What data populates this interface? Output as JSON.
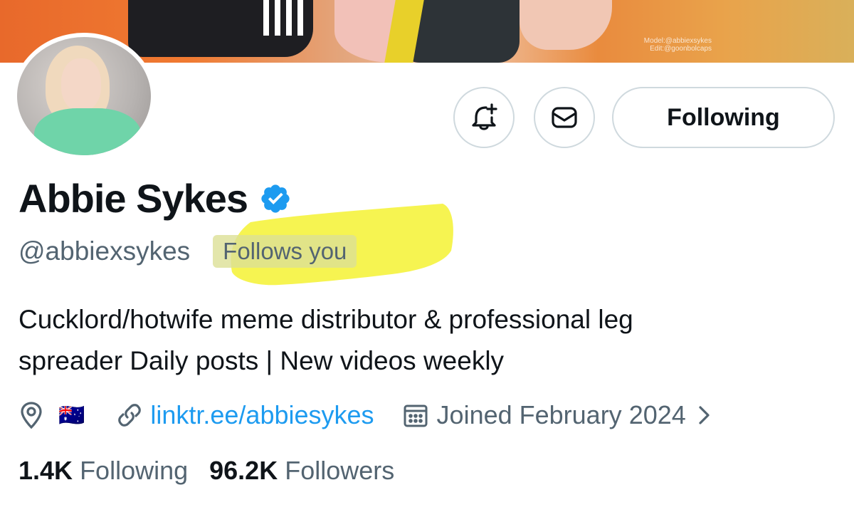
{
  "banner": {
    "credit_line1": "Model:@abbiexsykes",
    "credit_line2": "Edit:@goonbolcaps"
  },
  "actions": {
    "notify_icon": "bell-plus-icon",
    "message_icon": "envelope-icon",
    "following_label": "Following"
  },
  "profile": {
    "name": "Abbie Sykes",
    "verified_icon": "verified-badge-icon",
    "handle": "@abbiexsykes",
    "follows_you": "Follows you",
    "bio_line1": "Cucklord/hotwife meme distributor & professional leg",
    "bio_line2": "spreader Daily posts | New videos weekly",
    "location_icon": "location-pin-icon",
    "location_flag": "🇦🇺",
    "website": "linktr.ee/abbiesykes",
    "joined": "Joined February 2024",
    "following_count": "1.4K",
    "following_label": "Following",
    "followers_count": "96.2K",
    "followers_label": "Followers"
  },
  "colors": {
    "link": "#1d9bf0",
    "secondary_text": "#536471",
    "verified": "#1d9bf0",
    "highlight": "#f5f233"
  }
}
